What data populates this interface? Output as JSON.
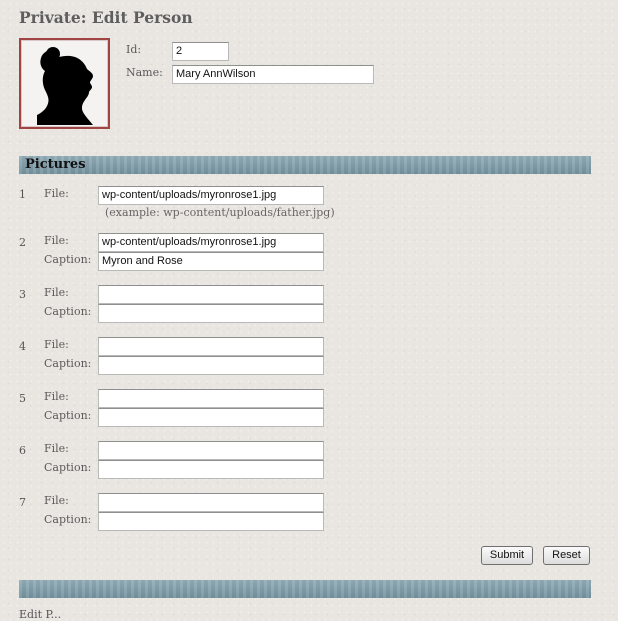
{
  "page": {
    "title": "Private: Edit Person"
  },
  "person": {
    "id_label": "Id:",
    "id_value": "2",
    "name_label": "Name:",
    "name_value": "Mary AnnWilson"
  },
  "pictures": {
    "section_title": "Pictures",
    "file_label": "File:",
    "caption_label": "Caption:",
    "example_text": "(example: wp-content/uploads/father.jpg)",
    "rows": [
      {
        "num": "1",
        "file": "wp-content/uploads/myronrose1.jpg",
        "caption": ""
      },
      {
        "num": "2",
        "file": "wp-content/uploads/myronrose1.jpg",
        "caption": "Myron and Rose"
      },
      {
        "num": "3",
        "file": "",
        "caption": ""
      },
      {
        "num": "4",
        "file": "",
        "caption": ""
      },
      {
        "num": "5",
        "file": "",
        "caption": ""
      },
      {
        "num": "6",
        "file": "",
        "caption": ""
      },
      {
        "num": "7",
        "file": "",
        "caption": ""
      }
    ]
  },
  "buttons": {
    "submit": "Submit",
    "reset": "Reset"
  },
  "footer": {
    "text": "Edit P..."
  },
  "colors": {
    "accent_bar": "#7b9ca9",
    "portrait_border": "#a04444"
  },
  "icons": {
    "portrait": "silhouette-portrait-icon"
  }
}
